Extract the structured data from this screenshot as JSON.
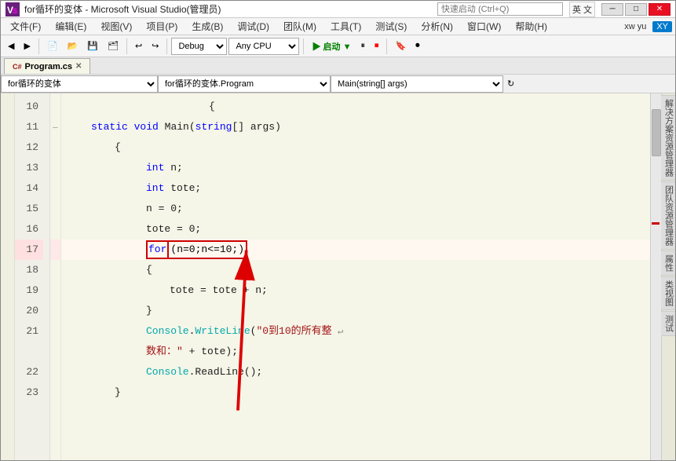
{
  "window": {
    "title": "for循环的变体 - Microsoft Visual Studio(管理员)",
    "logo_symbol": "▶",
    "min_btn": "─",
    "max_btn": "□",
    "close_btn": "✕"
  },
  "quicklaunch": {
    "placeholder": "快速启动 (Ctrl+Q)",
    "lang_label": "英 文",
    "user_label": "xw yu",
    "user_abbr": "XY"
  },
  "menu": {
    "items": [
      "文件(F)",
      "编辑(E)",
      "视图(V)",
      "项目(P)",
      "生成(B)",
      "调试(D)",
      "团队(M)",
      "工具(T)",
      "测试(S)",
      "分析(N)",
      "窗口(W)",
      "帮助(H)"
    ]
  },
  "toolbar": {
    "debug_config": "Debug",
    "platform": "Any CPU",
    "start_label": "▶ 启动 ▼"
  },
  "tabs": {
    "active_tab": "Program.cs",
    "active_tab_icon": "C#"
  },
  "nav_bar": {
    "project_path": "for循环的变体",
    "class_path": "for循环的变体.Program",
    "method_path": "Main(string[] args)"
  },
  "code": {
    "lines": [
      {
        "num": 10,
        "indent": 2,
        "content": "{",
        "tokens": [
          {
            "text": "{",
            "class": "plain"
          }
        ]
      },
      {
        "num": 11,
        "indent": 2,
        "content": "    static void Main(string[] args)",
        "tokens": [
          {
            "text": "    ",
            "class": "plain"
          },
          {
            "text": "static",
            "class": "kw-blue"
          },
          {
            "text": " ",
            "class": "plain"
          },
          {
            "text": "void",
            "class": "kw-blue"
          },
          {
            "text": " Main(",
            "class": "plain"
          },
          {
            "text": "string",
            "class": "kw-blue"
          },
          {
            "text": "[] args)",
            "class": "plain"
          }
        ]
      },
      {
        "num": 12,
        "indent": 2,
        "content": "    {",
        "tokens": [
          {
            "text": "    {",
            "class": "plain"
          }
        ]
      },
      {
        "num": 13,
        "indent": 3,
        "content": "        int n;",
        "tokens": [
          {
            "text": "        ",
            "class": "plain"
          },
          {
            "text": "int",
            "class": "kw-blue"
          },
          {
            "text": " n;",
            "class": "plain"
          }
        ]
      },
      {
        "num": 14,
        "indent": 3,
        "content": "        int tote;",
        "tokens": [
          {
            "text": "        ",
            "class": "plain"
          },
          {
            "text": "int",
            "class": "kw-blue"
          },
          {
            "text": " tote;",
            "class": "plain"
          }
        ]
      },
      {
        "num": 15,
        "indent": 3,
        "content": "        n = 0;",
        "tokens": [
          {
            "text": "        n = 0;",
            "class": "plain"
          }
        ]
      },
      {
        "num": 16,
        "indent": 3,
        "content": "        tote = 0;",
        "tokens": [
          {
            "text": "        tote = 0;",
            "class": "plain"
          }
        ]
      },
      {
        "num": 17,
        "indent": 3,
        "content": "        for(n=0;n<=10;)",
        "highlight_box": true,
        "tokens": [
          {
            "text": "        ",
            "class": "plain"
          },
          {
            "text": "for",
            "class": "kw-blue"
          },
          {
            "text": "(n=0;n<=10;)",
            "class": "plain"
          }
        ]
      },
      {
        "num": 18,
        "indent": 3,
        "content": "        {",
        "tokens": [
          {
            "text": "        {",
            "class": "plain"
          }
        ]
      },
      {
        "num": 19,
        "indent": 4,
        "content": "            tote = tote + n;",
        "tokens": [
          {
            "text": "            tote = tote + n;",
            "class": "plain"
          }
        ]
      },
      {
        "num": 20,
        "indent": 3,
        "content": "        }",
        "tokens": [
          {
            "text": "        }",
            "class": "plain"
          }
        ]
      },
      {
        "num": 21,
        "indent": 3,
        "content": "        Console.WriteLine(“0到10的所有整 →",
        "tokens": [
          {
            "text": "        ",
            "class": "plain"
          },
          {
            "text": "Console",
            "class": "kw-cyan"
          },
          {
            "text": ".",
            "class": "plain"
          },
          {
            "text": "WriteLine",
            "class": "plain"
          },
          {
            "text": "(“0到10的所有整 ↩",
            "class": "plain"
          }
        ]
      },
      {
        "num": 21,
        "indent": 3,
        "content_cont": "        数和：” + tote);",
        "tokens": [
          {
            "text": "        数和：” + tote);",
            "class": "plain"
          }
        ]
      },
      {
        "num": 22,
        "indent": 3,
        "content": "        Console.ReadLine();",
        "tokens": [
          {
            "text": "        ",
            "class": "plain"
          },
          {
            "text": "Console",
            "class": "kw-cyan"
          },
          {
            "text": ".ReadLine();",
            "class": "plain"
          }
        ]
      }
    ]
  },
  "side_tabs": {
    "right_tabs": [
      "解决方案资源管理器",
      "团队资源管理器",
      "属性",
      "类视图",
      "测试"
    ]
  },
  "colors": {
    "accent_blue": "#007acc",
    "kw_blue": "#0000ff",
    "kw_cyan": "#00aaaa",
    "highlight_box": "#cc0000",
    "line_bg": "#f5f5e8",
    "line_num_bg": "#f0f0e0"
  }
}
